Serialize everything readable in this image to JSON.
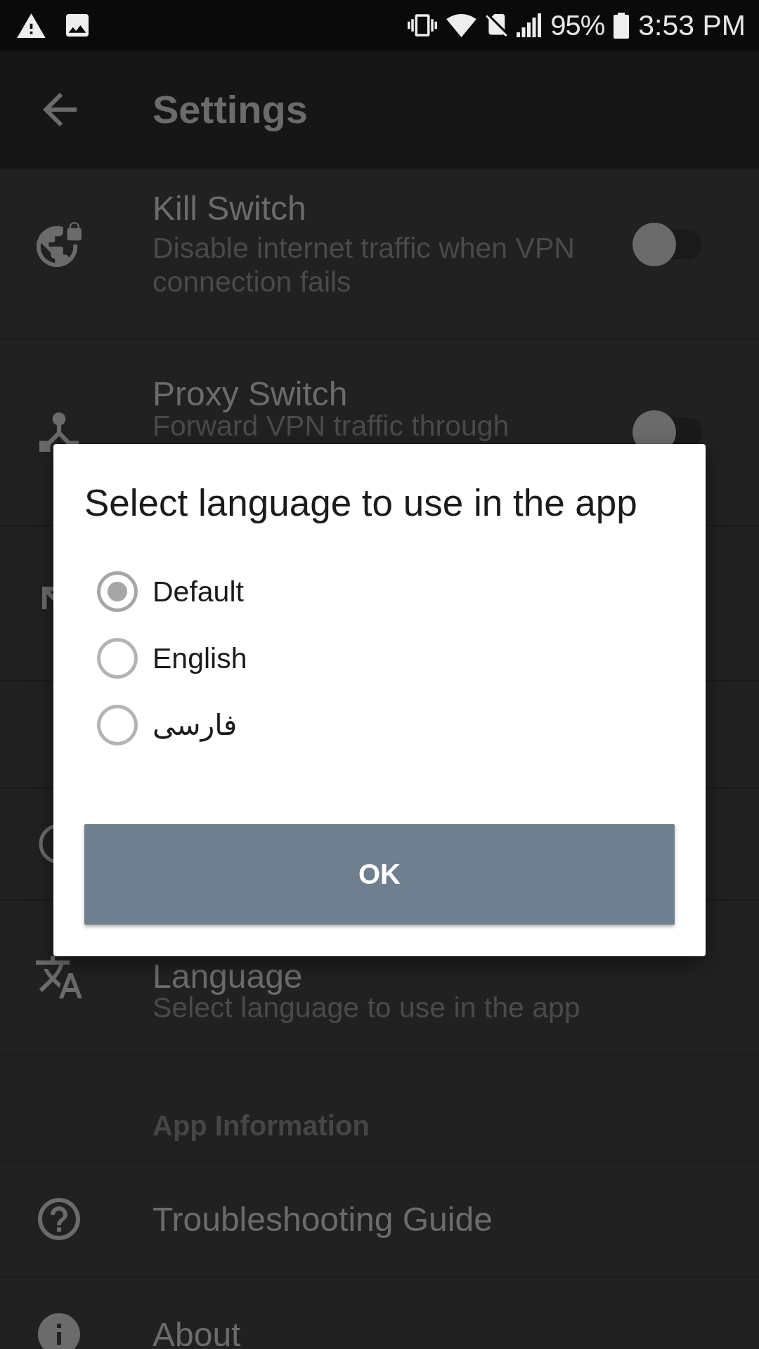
{
  "status_bar": {
    "battery": "95%",
    "time": "3:53 PM"
  },
  "app_bar": {
    "title": "Settings"
  },
  "settings": {
    "items": [
      {
        "kind": "switch",
        "title": "Kill Switch",
        "subtitle": "Disable internet traffic when VPN connection fails",
        "on": false
      },
      {
        "kind": "switch",
        "title": "Proxy Switch",
        "subtitle": "Forward VPN traffic through",
        "on": false
      },
      {
        "kind": "covered"
      },
      {
        "kind": "covered"
      },
      {
        "kind": "covered"
      },
      {
        "kind": "link",
        "title": "Language",
        "subtitle": "Select language to use in the app"
      },
      {
        "kind": "header",
        "title": "App Information"
      },
      {
        "kind": "link",
        "title": "Troubleshooting Guide"
      },
      {
        "kind": "link",
        "title": "About"
      }
    ]
  },
  "dialog": {
    "title": "Select language to use in the app",
    "options": [
      {
        "label": "Default",
        "selected": true
      },
      {
        "label": "English",
        "selected": false
      },
      {
        "label": "فارسی",
        "selected": false
      }
    ],
    "button": "OK"
  }
}
